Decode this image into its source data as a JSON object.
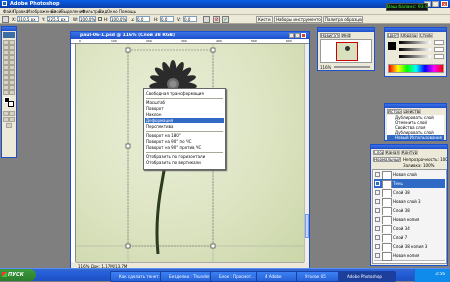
{
  "app": {
    "title": "Adobe Photoshop",
    "window_controls": [
      "_",
      "□",
      "×"
    ]
  },
  "menu_bar": [
    "Файл",
    "Правка",
    "Изображение",
    "Слой",
    "Выделение",
    "Фильтры",
    "Вид",
    "Окно",
    "Помощь"
  ],
  "options_bar": {
    "fields": [
      {
        "label": "X:",
        "value": "310,5 px"
      },
      {
        "label": "Y:",
        "value": "225,5 px"
      },
      {
        "label": "W:",
        "value": "100,0%"
      },
      {
        "label": "H:",
        "value": "100,0%"
      },
      {
        "label": "∠",
        "value": "0,0"
      },
      {
        "label": "H:",
        "value": "0,0"
      },
      {
        "label": "V:",
        "value": "0,0"
      }
    ],
    "right_tabs": [
      "Кисти",
      "Наборы инструментов",
      "Палитра образцов"
    ]
  },
  "balance_widget": {
    "text": "Ваш баланс: 93.95"
  },
  "document": {
    "title": "paul-06-1.psd @ 116% (Слой 38 RGB)",
    "ruler_marks": [
      "0",
      "100",
      "200",
      "300",
      "400",
      "500",
      "600"
    ],
    "status": "116%   Док: 1,17М/13,7М"
  },
  "context_menu": {
    "items": [
      {
        "label": "Свободная трансформация",
        "highlighted": false
      },
      {
        "label": "Масштаб",
        "highlighted": false
      },
      {
        "label": "Поворот",
        "highlighted": false
      },
      {
        "label": "Наклон",
        "highlighted": false
      },
      {
        "label": "Деформация",
        "highlighted": true
      },
      {
        "label": "Перспектива",
        "highlighted": false
      },
      {
        "label": "Поворот на 180°",
        "highlighted": false
      },
      {
        "label": "Поворот на 90° по ЧС",
        "highlighted": false
      },
      {
        "label": "Поворот на 90° против ЧС",
        "highlighted": false
      },
      {
        "label": "Отобразить по горизонтали",
        "highlighted": false
      },
      {
        "label": "Отобразить по вертикали",
        "highlighted": false
      }
    ]
  },
  "navigator_panel": {
    "tabs": [
      "Навигатор",
      "Инфо"
    ],
    "zoom": "116%"
  },
  "color_panel": {
    "tabs": [
      "Цвет",
      "Образцы",
      "Стили"
    ]
  },
  "history_panel": {
    "tabs": [
      "История",
      "Действия"
    ],
    "items": [
      "Дублировать слой",
      "Отменить слой",
      "Свойства слоя",
      "Дублировать слой",
      "Новый  Использования"
    ]
  },
  "layers_panel": {
    "tabs": [
      "Слои",
      "Каналы",
      "Контуры"
    ],
    "blend_mode": "Нормальный",
    "opacity": "Непрозрачность: 100%",
    "fill": "Заливка: 100%",
    "layers": [
      "Новая слой",
      "Тень",
      "Слой 38",
      "Новая слой 3",
      "Слой 38",
      "Новая копия",
      "Слой 34",
      "Слой 7",
      "Слой 38 копия 3",
      "Новая копия"
    ]
  },
  "taskbar": {
    "start_label": "ПУСК",
    "buttons": [
      {
        "label": "Как сделать тенет...",
        "active": false
      },
      {
        "label": "Безделки : Thunder...",
        "active": false
      },
      {
        "label": "Блок : Просмот...",
        "active": false
      },
      {
        "label": "4 Adobe",
        "active": false
      },
      {
        "label": "Уголок 05",
        "active": false
      },
      {
        "label": "Adobe Photoshop",
        "active": true
      }
    ],
    "clock": "3:56"
  }
}
